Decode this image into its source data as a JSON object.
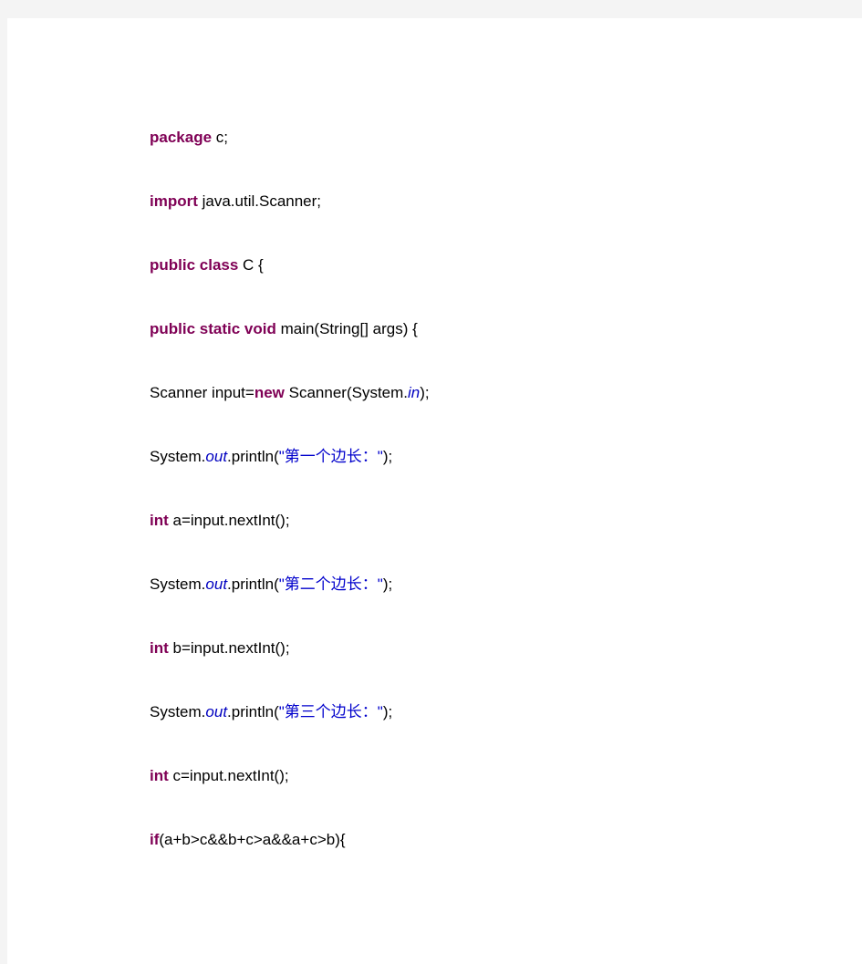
{
  "document": {
    "background_color": "#f4f4f4",
    "page_color": "#ffffff",
    "language": "Java"
  },
  "theme": {
    "keyword_color": "#7f0055",
    "plain_color": "#000000",
    "field_color": "#0000c0",
    "string_color": "#0000cc"
  },
  "code": {
    "lines": [
      {
        "index": 0,
        "text": "package c;",
        "tokens": [
          {
            "t": "package",
            "k": "keyword"
          },
          {
            "t": " c;",
            "k": "plain"
          }
        ]
      },
      {
        "index": 1,
        "text": "import java.util.Scanner;",
        "tokens": [
          {
            "t": "import",
            "k": "keyword"
          },
          {
            "t": " java.util.Scanner;",
            "k": "plain"
          }
        ]
      },
      {
        "index": 2,
        "text": "public class C {",
        "tokens": [
          {
            "t": "public class",
            "k": "keyword"
          },
          {
            "t": " C {",
            "k": "plain"
          }
        ]
      },
      {
        "index": 3,
        "text": "public static void main(String[] args) {",
        "tokens": [
          {
            "t": "public static void",
            "k": "keyword"
          },
          {
            "t": " main(String[] args) {",
            "k": "plain"
          }
        ]
      },
      {
        "index": 4,
        "text": "Scanner input=new Scanner(System.in);",
        "tokens": [
          {
            "t": "Scanner input=",
            "k": "plain"
          },
          {
            "t": "new",
            "k": "keyword"
          },
          {
            "t": " Scanner(System.",
            "k": "plain"
          },
          {
            "t": "in",
            "k": "field"
          },
          {
            "t": ");",
            "k": "plain"
          }
        ]
      },
      {
        "index": 5,
        "text": "System.out.println(\"第一个边长：\");",
        "tokens": [
          {
            "t": "System.",
            "k": "plain"
          },
          {
            "t": "out",
            "k": "field"
          },
          {
            "t": ".println(",
            "k": "plain"
          },
          {
            "t": "\"第一个边长：\"",
            "k": "string"
          },
          {
            "t": ");",
            "k": "plain"
          }
        ]
      },
      {
        "index": 6,
        "text": "int a=input.nextInt();",
        "tokens": [
          {
            "t": "int",
            "k": "keyword"
          },
          {
            "t": " a=input.nextInt();",
            "k": "plain"
          }
        ]
      },
      {
        "index": 7,
        "text": "System.out.println(\"第二个边长：\");",
        "tokens": [
          {
            "t": "System.",
            "k": "plain"
          },
          {
            "t": "out",
            "k": "field"
          },
          {
            "t": ".println(",
            "k": "plain"
          },
          {
            "t": "\"第二个边长：\"",
            "k": "string"
          },
          {
            "t": ");",
            "k": "plain"
          }
        ]
      },
      {
        "index": 8,
        "text": "int b=input.nextInt();",
        "tokens": [
          {
            "t": "int",
            "k": "keyword"
          },
          {
            "t": " b=input.nextInt();",
            "k": "plain"
          }
        ]
      },
      {
        "index": 9,
        "text": "System.out.println(\"第三个边长：\");",
        "tokens": [
          {
            "t": "System.",
            "k": "plain"
          },
          {
            "t": "out",
            "k": "field"
          },
          {
            "t": ".println(",
            "k": "plain"
          },
          {
            "t": "\"第三个边长：\"",
            "k": "string"
          },
          {
            "t": ");",
            "k": "plain"
          }
        ]
      },
      {
        "index": 10,
        "text": "int c=input.nextInt();",
        "tokens": [
          {
            "t": "int",
            "k": "keyword"
          },
          {
            "t": " c=input.nextInt();",
            "k": "plain"
          }
        ]
      },
      {
        "index": 11,
        "text": "if(a+b>c&&b+c>a&&a+c>b){",
        "tokens": [
          {
            "t": "if",
            "k": "keyword"
          },
          {
            "t": "(a+b>c&&b+c>a&&a+c>b){",
            "k": "plain"
          }
        ]
      }
    ]
  }
}
